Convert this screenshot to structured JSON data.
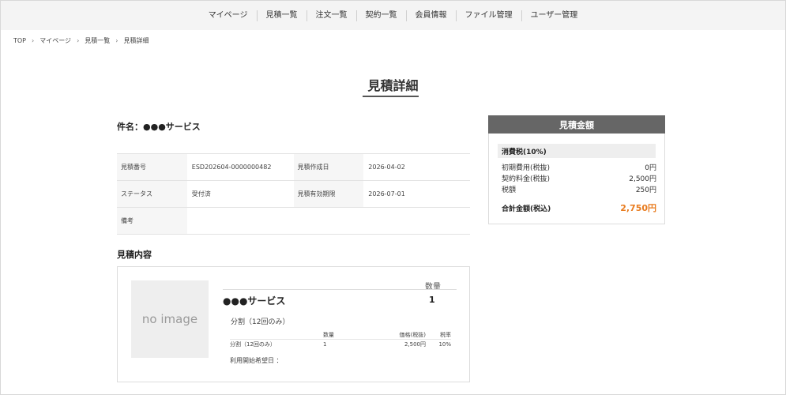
{
  "nav": {
    "items": [
      "マイページ",
      "見積一覧",
      "注文一覧",
      "契約一覧",
      "会員情報",
      "ファイル管理",
      "ユーザー管理"
    ]
  },
  "breadcrumb": {
    "items": [
      "TOP",
      "マイページ",
      "見積一覧",
      "見積詳細"
    ],
    "separator": "›"
  },
  "page": {
    "title": "見積詳細"
  },
  "subject": {
    "label": "件名：",
    "value": "●●●サービス"
  },
  "info": {
    "estimate_no_label": "見積番号",
    "estimate_no": "ESD202604-0000000482",
    "created_label": "見積作成日",
    "created": "2026-04-02",
    "status_label": "ステータス",
    "status": "受付済",
    "expiry_label": "見積有効期限",
    "expiry": "2026-07-01",
    "remarks_label": "備考",
    "remarks": ""
  },
  "content": {
    "section_title": "見積内容",
    "no_image": "no image",
    "qty_header": "数量",
    "product_name": "●●●サービス",
    "product_qty": "1",
    "plan_name": "分割（12回のみ）",
    "table_headers": [
      "",
      "数量",
      "価格(税抜)",
      "税率"
    ],
    "table_row": [
      "分割（12回のみ）",
      "1",
      "2,500円",
      "10%"
    ],
    "start_date_label": "利用開始希望日 ："
  },
  "estimate": {
    "header": "見積金額",
    "tax_label": "消費税(10%)",
    "initial_label": "初期費用(税抜)",
    "initial_value": "0円",
    "contract_label": "契約料金(税抜)",
    "contract_value": "2,500円",
    "tax_amount_label": "税額",
    "tax_amount_value": "250円",
    "total_label": "合計金額(税込)",
    "total_value": "2,750円"
  }
}
